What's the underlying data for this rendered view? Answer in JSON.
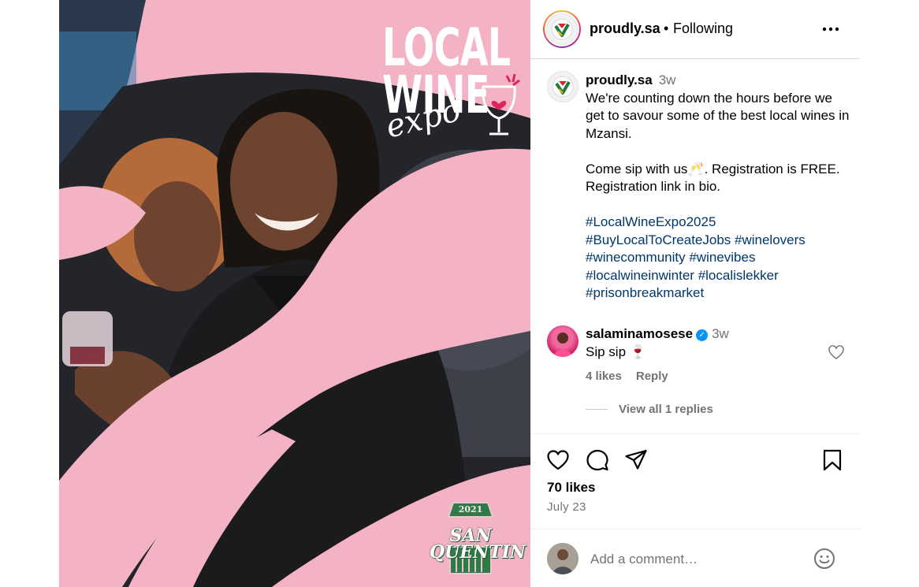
{
  "post_image": {
    "logo_line1": "LOCAL",
    "logo_line2": "WINE",
    "logo_script": "expo",
    "badge_year": "2021",
    "badge_name_line1": "SAN",
    "badge_name_line2": "QUENTIN"
  },
  "header": {
    "username": "proudly.sa",
    "separator": "•",
    "follow_status": "Following",
    "more_icon": "more-horizontal-icon"
  },
  "caption": {
    "username": "proudly.sa",
    "time": "3w",
    "line1": "We're counting down the hours before we get to savour some of the best local wines in Mzansi.",
    "line2": "Come sip with us🥂. Registration is FREE. Registration link in bio.",
    "hashtags": [
      "#LocalWineExpo2025",
      "#BuyLocalToCreateJobs",
      "#winelovers",
      "#winecommunity",
      "#winevibes",
      "#localwineinwinter",
      "#localislekker",
      "#prisonbreakmarket"
    ]
  },
  "comment": {
    "username": "salaminamosese",
    "verified_icon": "verified-badge-icon",
    "time": "3w",
    "text": "Sip sip 🍷",
    "likes": "4 likes",
    "reply": "Reply",
    "view_replies": "View all 1 replies"
  },
  "actions": {
    "like_icon": "heart-icon",
    "comment_icon": "comment-icon",
    "share_icon": "send-icon",
    "save_icon": "bookmark-icon"
  },
  "likes": "70 likes",
  "date": "July 23",
  "add_comment": {
    "placeholder": "Add a comment…",
    "emoji_icon": "emoji-icon"
  },
  "colors": {
    "pink_background": "#f4b3c5",
    "hashtag": "#00376b",
    "muted": "#737373",
    "verified": "#0095f6"
  }
}
